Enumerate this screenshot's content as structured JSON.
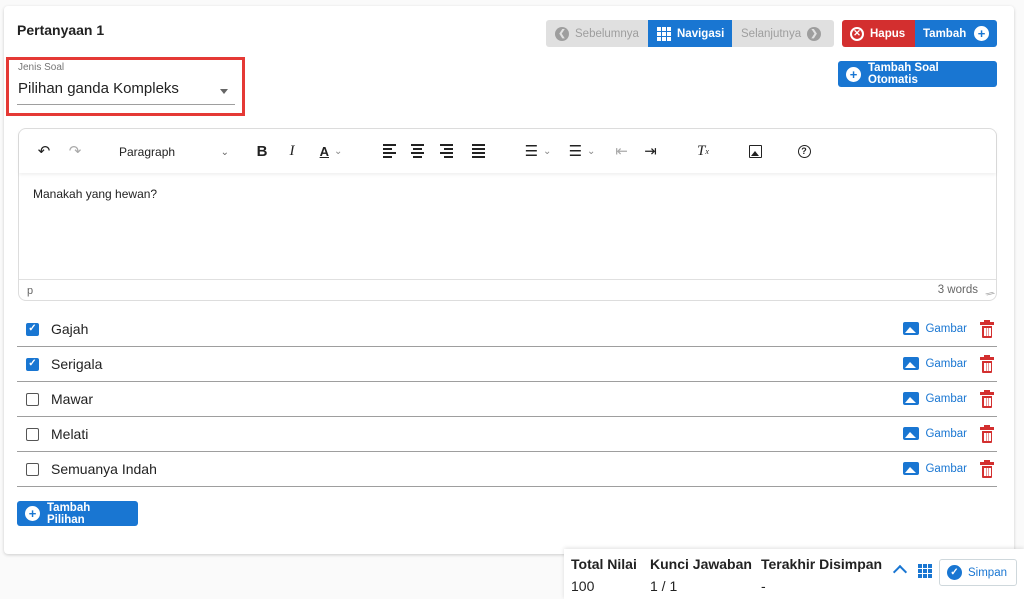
{
  "question": {
    "title": "Pertanyaan 1"
  },
  "nav": {
    "prev_label": "Sebelumnya",
    "nav_label": "Navigasi",
    "next_label": "Selanjutnya"
  },
  "actions": {
    "delete_label": "Hapus",
    "add_label": "Tambah",
    "auto_add_label": "Tambah Soal Otomatis"
  },
  "question_type": {
    "label": "Jenis Soal",
    "value": "Pilihan ganda Kompleks"
  },
  "editor": {
    "block_format": "Paragraph",
    "content": "Manakah yang hewan?",
    "path": "p",
    "word_count": "3 words"
  },
  "options": [
    {
      "label": "Gajah",
      "checked": true,
      "image_label": "Gambar"
    },
    {
      "label": "Serigala",
      "checked": true,
      "image_label": "Gambar"
    },
    {
      "label": "Mawar",
      "checked": false,
      "image_label": "Gambar"
    },
    {
      "label": "Melati",
      "checked": false,
      "image_label": "Gambar"
    },
    {
      "label": "Semuanya Indah",
      "checked": false,
      "image_label": "Gambar"
    }
  ],
  "add_option_label": "Tambah Pilihan",
  "summary": {
    "total_label": "Total Nilai",
    "total_value": "100",
    "key_label": "Kunci Jawaban",
    "key_value": "1 / 1",
    "saved_label": "Terakhir Disimpan",
    "saved_value": "-",
    "save_label": "Simpan"
  },
  "colors": {
    "primary": "#1976d2",
    "danger": "#d32f2f",
    "highlight": "#e53935"
  }
}
